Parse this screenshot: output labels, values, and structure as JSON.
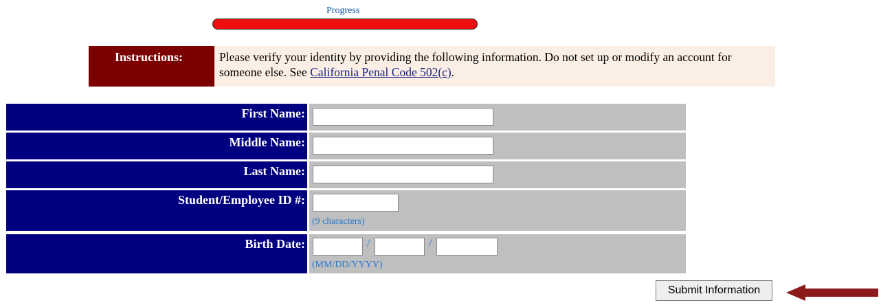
{
  "progress": {
    "label": "Progress",
    "fraction": 1.0,
    "color": "#ef0e0e"
  },
  "instructions": {
    "label": "Instructions:",
    "text_before": "Please verify your identity by providing the following information. Do not set up or modify an account for someone else. See ",
    "link_text": "California Penal Code 502(c)",
    "text_after": "."
  },
  "form": {
    "first_name": {
      "label": "First Name:",
      "value": ""
    },
    "middle_name": {
      "label": "Middle Name:",
      "value": ""
    },
    "last_name": {
      "label": "Last Name:",
      "value": ""
    },
    "student_id": {
      "label": "Student/Employee ID #:",
      "value": "",
      "hint": "(9 characters)"
    },
    "birth_date": {
      "label": "Birth Date:",
      "month": "",
      "day": "",
      "year": "",
      "separator": "/",
      "hint": "(MM/DD/YYYY)"
    }
  },
  "submit_label": "Submit Information",
  "colors": {
    "label_bg": "#000080",
    "field_bg": "#bfbfbf",
    "instructions_label_bg": "#7b0000",
    "instructions_bg": "#fbefe5",
    "hint": "#2478d4",
    "arrow": "#8b1a1a"
  },
  "icons": {
    "pointer": "left-arrow-icon"
  }
}
